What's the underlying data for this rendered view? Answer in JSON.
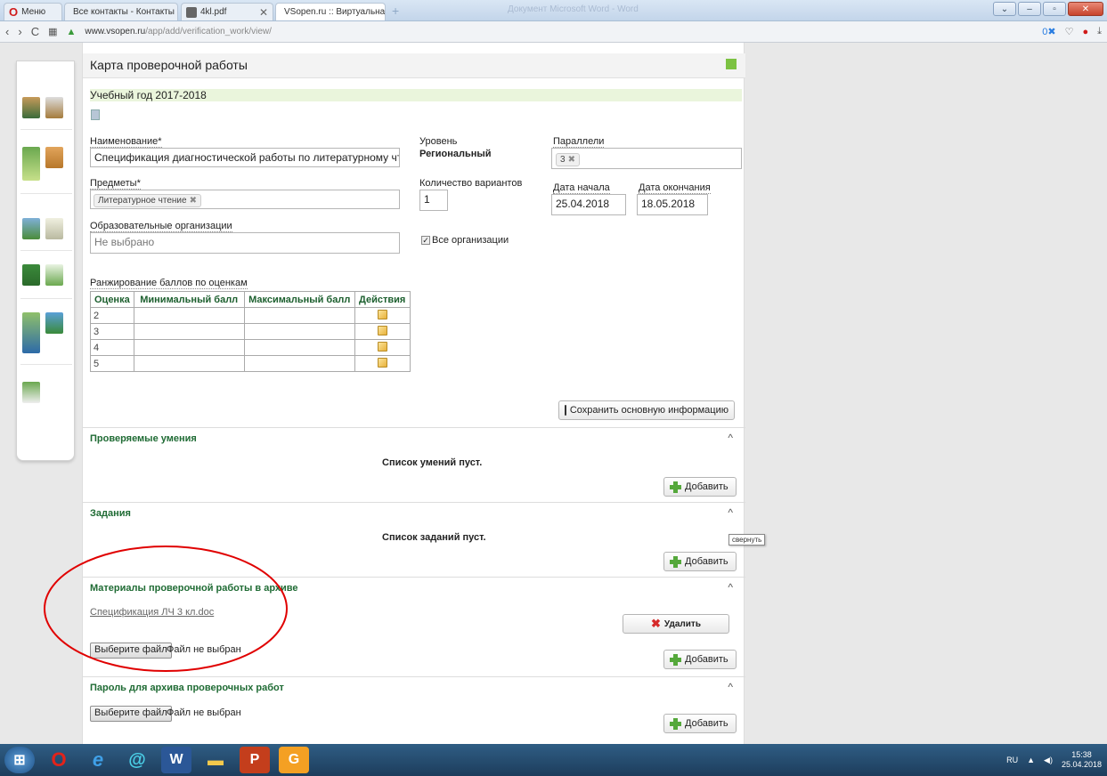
{
  "browser": {
    "menu_label": "Меню",
    "tabs": [
      {
        "label": "Все контакты - Контакты"
      },
      {
        "label": "4kl.pdf"
      },
      {
        "label": "VSopen.ru :: Виртуальная"
      }
    ],
    "window_title": "Документ Microsoft Word - Word",
    "url_host": "www.vsopen.ru",
    "url_path": "/app/add/verification_work/view/"
  },
  "page": {
    "title": "Карта проверочной работы",
    "school_year": "Учебный год 2017-2018"
  },
  "form": {
    "name_label": "Наименование*",
    "name_value": "Спецификация диагностической работы по литературному чтению для",
    "level_label": "Уровень",
    "level_value": "Региональный",
    "parallels_label": "Параллели",
    "parallels_chip": "3",
    "subjects_label": "Предметы*",
    "subjects_chip": "Литературное чтение",
    "variants_label": "Количество вариантов",
    "variants_value": "1",
    "start_label": "Дата начала",
    "start_value": "25.04.2018",
    "end_label": "Дата окончания",
    "end_value": "18.05.2018",
    "orgs_label": "Образовательные организации",
    "orgs_placeholder": "Не выбрано",
    "all_orgs_label": "Все организации",
    "ranking_label": "Ранжирование баллов по оценкам",
    "ranking_headers": [
      "Оценка",
      "Минимальный балл",
      "Максимальный балл",
      "Действия"
    ],
    "ranking_rows": [
      {
        "grade": "2"
      },
      {
        "grade": "3"
      },
      {
        "grade": "4"
      },
      {
        "grade": "5"
      }
    ],
    "save_button": "Сохранить основную информацию"
  },
  "sections": {
    "skills": {
      "title": "Проверяемые умения",
      "empty": "Список умений пуст.",
      "add": "Добавить"
    },
    "tasks": {
      "title": "Задания",
      "empty": "Список заданий пуст.",
      "add": "Добавить",
      "tooltip": "свернуть"
    },
    "materials": {
      "title": "Материалы проверочной работы в архиве",
      "file_link": "Спецификация ЛЧ 3 кл.doc",
      "delete": "Удалить",
      "choose": "Выберите файл",
      "no_file": "Файл не выбран",
      "add": "Добавить"
    },
    "password": {
      "title": "Пароль для архива проверочных работ",
      "choose": "Выберите файл",
      "no_file": "Файл не выбран",
      "add": "Добавить"
    }
  },
  "taskbar": {
    "lang": "RU",
    "time": "15:38",
    "date": "25.04.2018"
  },
  "colors": {
    "accent_green": "#1f6b34",
    "highlight_circle": "#e00000"
  }
}
